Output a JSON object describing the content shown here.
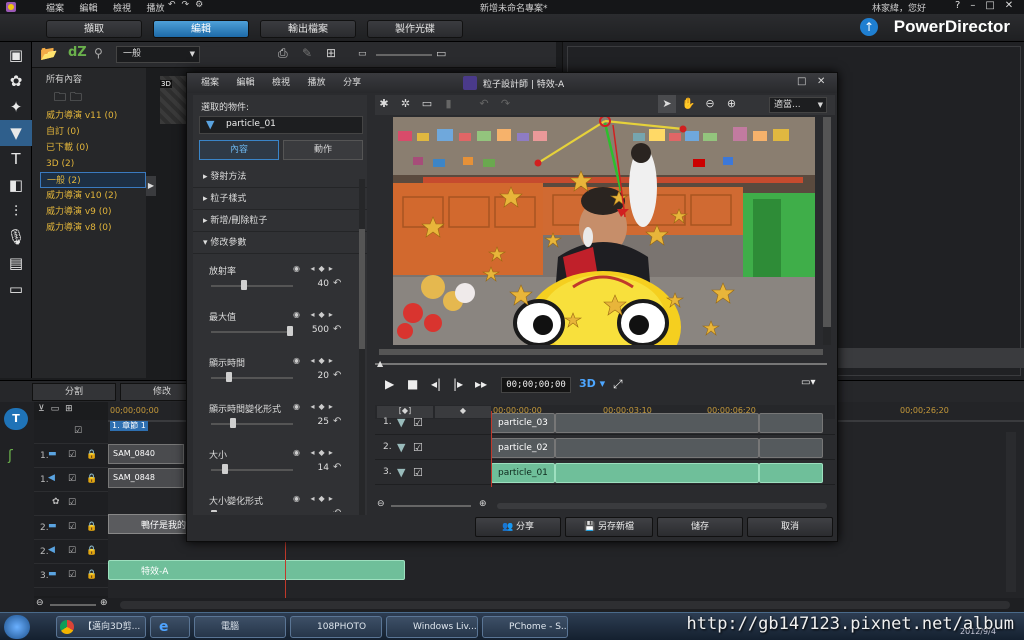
{
  "main_menu": [
    "檔案",
    "編輯",
    "檢視",
    "播放"
  ],
  "window_title": "新增未命名專案*",
  "user": "林家緯，您好",
  "modes": [
    "擷取",
    "編輯",
    "輸出檔案",
    "製作光碟"
  ],
  "active_mode_index": 1,
  "brand": "PowerDirector",
  "library": {
    "filter": "一般",
    "tree": [
      {
        "label": "所有內容",
        "kind": "root"
      },
      {
        "label": "威力導演 v11  (0)"
      },
      {
        "label": "自訂  (0)"
      },
      {
        "label": "已下載  (0)"
      },
      {
        "label": "3D  (2)"
      },
      {
        "label": "一般  (2)",
        "selected": true
      },
      {
        "label": "威力導演 v10  (2)"
      },
      {
        "label": "威力導演 v9  (0)"
      },
      {
        "label": "威力導演 v8  (0)"
      }
    ],
    "thumb_badge": "3D"
  },
  "timeline": {
    "split_label": "分割",
    "modify_label": "修改",
    "timecodes": [
      "00;00;00;00",
      "00;00;26;20"
    ],
    "chapter_label": "1. 章節 1",
    "clips": [
      "SAM_0840",
      "SAM_0848",
      "鴨仔是我的",
      "特效-A"
    ],
    "rows": [
      "1.",
      "1.",
      "2.",
      "2.",
      "3.",
      "3."
    ]
  },
  "dialog": {
    "app_icon": "particle-designer-icon",
    "title": "粒子設計師 | 特效-A",
    "menu": [
      "檔案",
      "編輯",
      "檢視",
      "播放",
      "分享"
    ],
    "selected_object_label": "選取的物件:",
    "selected_object": "particle_01",
    "tabs": [
      "內容",
      "動作"
    ],
    "sections": [
      "發射方法",
      "粒子樣式",
      "新增/刪除粒子",
      "修改參數"
    ],
    "params": [
      {
        "label": "放射率",
        "value": "40",
        "fraction": 0.4
      },
      {
        "label": "最大值",
        "value": "500",
        "fraction": 1.0
      },
      {
        "label": "顯示時間",
        "value": "20",
        "fraction": 0.2
      },
      {
        "label": "顯示時間變化形式",
        "value": "25",
        "fraction": 0.25
      },
      {
        "label": "大小",
        "value": "14",
        "fraction": 0.14
      },
      {
        "label": "大小變化形式",
        "value": "",
        "fraction": 0.0
      }
    ],
    "zoom_select": "適當...",
    "timecode": "00;00;00;00",
    "timeline_ticks": [
      "00;00;00;00",
      "00;00;03;10",
      "00;00;06;20"
    ],
    "particle_rows": [
      "particle_03",
      "particle_02",
      "particle_01"
    ],
    "buttons": {
      "share": "分享",
      "save_as": "另存新檔",
      "save": "儲存",
      "cancel": "取消"
    }
  },
  "taskbar": {
    "tasks": [
      "【邁向3D剪...",
      "電腦",
      "108PHOTO",
      "Windows Liv...",
      "PChome - S..."
    ],
    "watermark": "http://gb147123.pixnet.net/album",
    "date": "2012/9/4"
  },
  "colors": {
    "accent": "#2e86d0",
    "particle_green": "#6fbf9a",
    "folder_yellow": "#e2b53b",
    "playhead": "#c0392b"
  }
}
